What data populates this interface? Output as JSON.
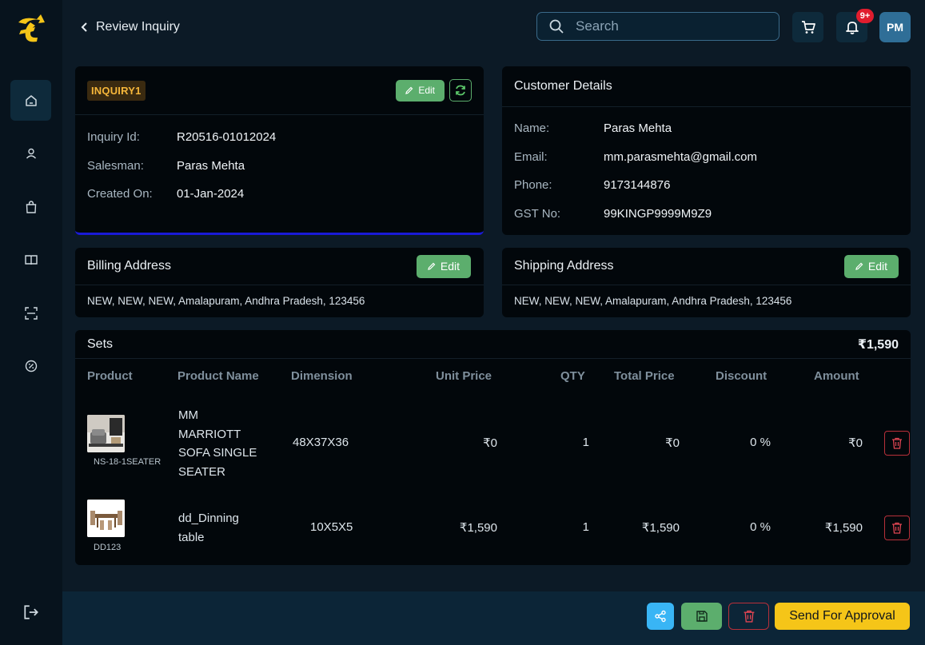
{
  "header": {
    "back_label": "Review Inquiry",
    "search_placeholder": "Search",
    "notification_count": "9+",
    "avatar_initials": "PM"
  },
  "sidebar": {
    "items": [
      {
        "icon": "home-icon",
        "active": true
      },
      {
        "icon": "user-icon",
        "active": false
      },
      {
        "icon": "shopping-bag-icon",
        "active": false
      },
      {
        "icon": "book-icon",
        "active": false
      },
      {
        "icon": "scan-icon",
        "active": false
      },
      {
        "icon": "discount-icon",
        "active": false
      }
    ],
    "logout_icon": "logout-icon"
  },
  "inquiry": {
    "chip": "INQUIRY1",
    "edit_label": "Edit",
    "fields": [
      {
        "label": "Inquiry Id:",
        "value": "R20516-01012024"
      },
      {
        "label": "Salesman:",
        "value": "Paras Mehta"
      },
      {
        "label": "Created On:",
        "value": "01-Jan-2024"
      }
    ]
  },
  "customer": {
    "title": "Customer Details",
    "fields": [
      {
        "label": "Name:",
        "value": "Paras Mehta"
      },
      {
        "label": "Email:",
        "value": "mm.parasmehta@gmail.com"
      },
      {
        "label": "Phone:",
        "value": "9173144876"
      },
      {
        "label": "GST No:",
        "value": "99KINGP9999M9Z9"
      }
    ]
  },
  "billing": {
    "title": "Billing Address",
    "edit_label": "Edit",
    "address": "NEW, NEW, NEW, Amalapuram, Andhra Pradesh, 123456"
  },
  "shipping": {
    "title": "Shipping Address",
    "edit_label": "Edit",
    "address": "NEW, NEW, NEW, Amalapuram, Andhra Pradesh, 123456"
  },
  "sets": {
    "title": "Sets",
    "total": "₹1,590",
    "columns": [
      "Product",
      "Product Name",
      "Dimension",
      "Unit Price",
      "QTY",
      "Total Price",
      "Discount",
      "Amount"
    ],
    "rows": [
      {
        "sku": "NS-18-1SEATER",
        "name_lines": [
          "MM",
          "MARRIOTT",
          "SOFA SINGLE",
          "SEATER"
        ],
        "dimension": "48X37X36",
        "unit_price": "₹0",
        "qty": "1",
        "total_price": "₹0",
        "discount": "0 %",
        "amount": "₹0"
      },
      {
        "sku": "DD123",
        "name_lines": [
          "dd_Dinning",
          "table"
        ],
        "dimension": "10X5X5",
        "unit_price": "₹1,590",
        "qty": "1",
        "total_price": "₹1,590",
        "discount": "0 %",
        "amount": "₹1,590"
      }
    ]
  },
  "footer": {
    "share_icon": "share-icon",
    "save_icon": "save-icon",
    "delete_icon": "trash-icon",
    "approve_label": "Send For Approval"
  },
  "colors": {
    "accent_green": "#5cae6d",
    "accent_yellow": "#f5c518",
    "accent_blue": "#39b5f5",
    "danger": "#b8303a",
    "chip_text": "#f5b63a"
  }
}
